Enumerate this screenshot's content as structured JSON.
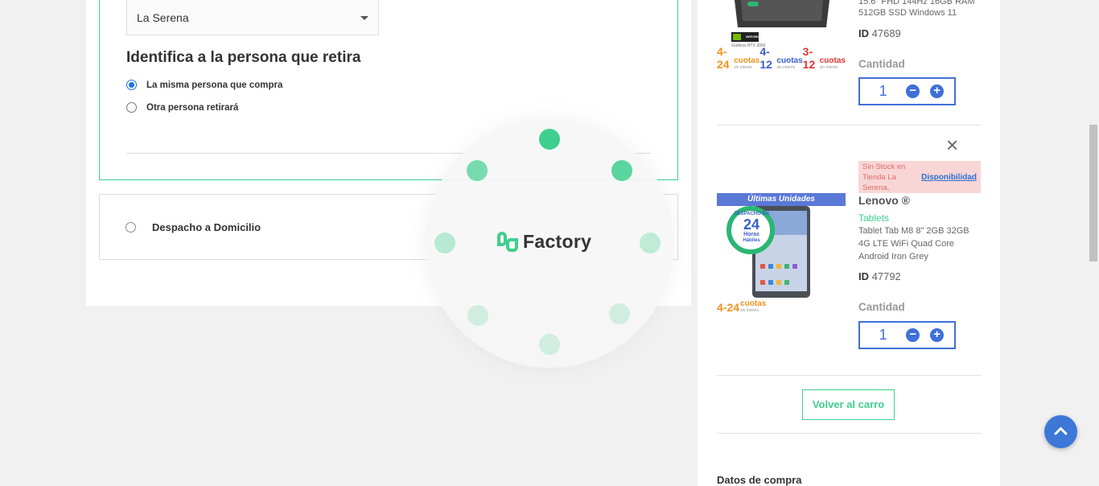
{
  "pickup": {
    "selected_store": "La Serena",
    "section_title": "Identifica a la persona que retira",
    "option_same": "La misma persona que compra",
    "option_other": "Otra persona retirará"
  },
  "delivery": {
    "label": "Despacho a Domicilio"
  },
  "loader": {
    "logo_text": "Factory"
  },
  "cart": {
    "item1": {
      "desc_line1": "15.6\" FHD 144Hz 16GB RAM",
      "desc_line2": "512GB SSD Windows 11",
      "id_label": "ID",
      "id": "47689",
      "qty_label": "Cantidad",
      "qty": "1",
      "img_label_badge": "GEFORCE RTX",
      "img_label_badge_sub": "Gráficos RTX 3050",
      "inst_1": "4-24",
      "inst_1_word": "cuotas",
      "inst_1_sub": "sin interés",
      "inst_2": "4-12",
      "inst_2_word": "cuotas",
      "inst_2_sub": "sin interés",
      "inst_3": "3-12",
      "inst_3_word": "cuotas",
      "inst_3_sub": "sin interés"
    },
    "item2": {
      "stock_msg": "Sin Stock en Tienda La Serena,",
      "stock_link": "Disponibilidad",
      "badge": "Últimas Unidades",
      "despacho_top": "DESPACHO EN",
      "despacho_num": "24",
      "despacho_unit": "Horas",
      "despacho_word": "Hábiles",
      "brand": "Lenovo ®",
      "category": "Tablets",
      "desc_line1": "Tablet Tab M8 8\" 2GB 32GB",
      "desc_line2": "4G LTE WiFi Quad Core",
      "desc_line3": "Android Iron Grey",
      "id_label": "ID",
      "id": "47792",
      "qty_label": "Cantidad",
      "qty": "1",
      "inst_1": "4-24",
      "inst_1_word": "cuotas",
      "inst_1_sub": "sin interés"
    },
    "back_button": "Volver al carro",
    "summary_title": "Datos de compra"
  },
  "colors": {
    "accent": "#3ecf8e",
    "primary_blue": "#3f6fd8",
    "stock_bg": "#f9d6d6"
  }
}
